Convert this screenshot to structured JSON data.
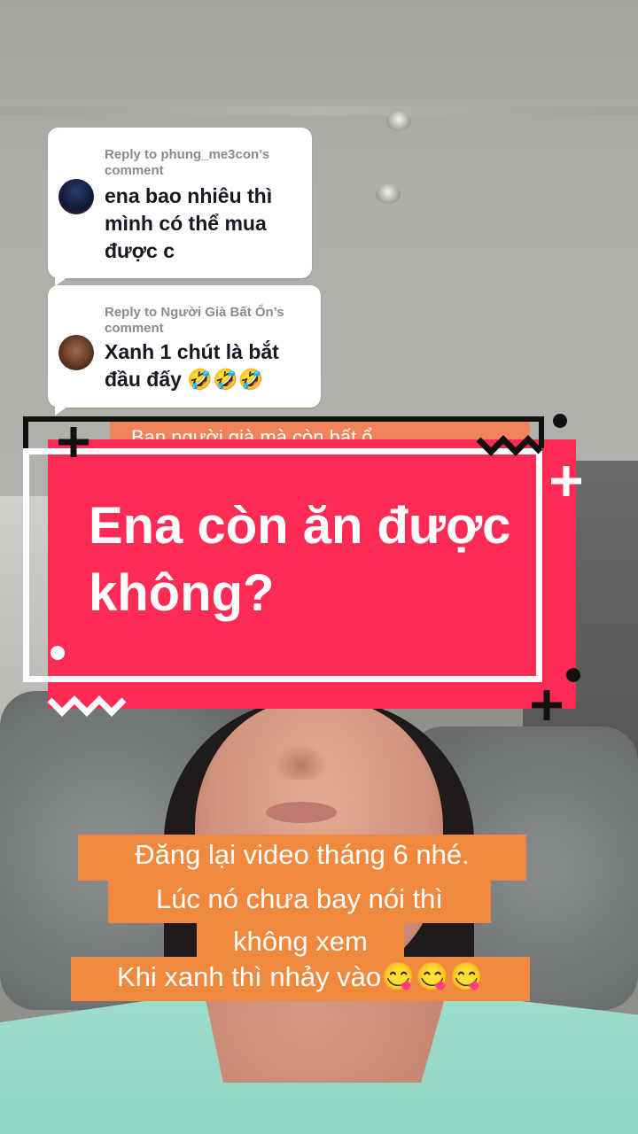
{
  "comments": [
    {
      "reply_to": "Reply to phung_me3con’s comment",
      "text": "ena bao nhiêu thì mình có thể mua được c"
    },
    {
      "reply_to": "Reply to Người Già Bất Ổn’s comment",
      "text": "Xanh 1 chút là bắt đầu đấy 🤣🤣🤣"
    }
  ],
  "sticker": {
    "partial_text_behind": "Bạn người già mà còn bất ổ",
    "question": "Ena còn ăn được không?",
    "accent_color": "#fe2c55"
  },
  "caption": {
    "lines": [
      "Đăng lại video tháng 6 nhé.",
      "Lúc nó chưa bay nói thì",
      "không xem",
      "Khi xanh thì nhảy vào😋😋😋"
    ],
    "background_color": "#f0883e"
  }
}
